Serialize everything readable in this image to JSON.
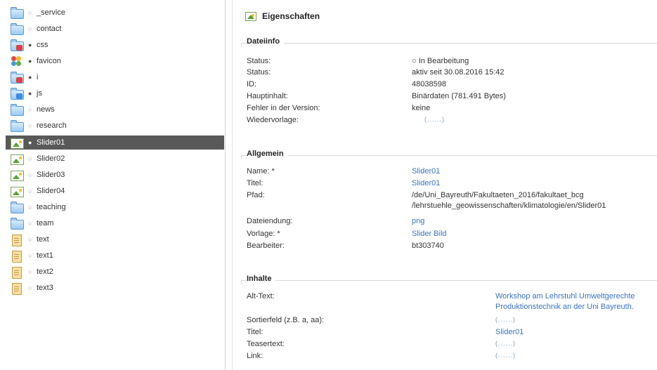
{
  "tree": {
    "items": [
      {
        "label": "_service",
        "icon": "folder-icon",
        "bullet": "○"
      },
      {
        "label": "contact",
        "icon": "folder-icon",
        "bullet": "○"
      },
      {
        "label": "css",
        "icon": "folder-sub-icon",
        "bullet": "●"
      },
      {
        "label": "favicon",
        "icon": "favicon-icon",
        "bullet": "●"
      },
      {
        "label": "i",
        "icon": "folder-sub-icon",
        "bullet": "●"
      },
      {
        "label": "js",
        "icon": "folder-sub-icon",
        "bullet": "●"
      },
      {
        "label": "news",
        "icon": "folder-icon",
        "bullet": "○"
      },
      {
        "label": "research",
        "icon": "folder-icon",
        "bullet": "○"
      },
      {
        "label": "Slider01",
        "icon": "image-icon",
        "bullet": "●",
        "selected": true
      },
      {
        "label": "Slider02",
        "icon": "image-icon",
        "bullet": "○"
      },
      {
        "label": "Slider03",
        "icon": "image-icon",
        "bullet": "○"
      },
      {
        "label": "Slider04",
        "icon": "image-icon",
        "bullet": "○"
      },
      {
        "label": "teaching",
        "icon": "folder-icon",
        "bullet": "○"
      },
      {
        "label": "team",
        "icon": "folder-icon",
        "bullet": "○"
      },
      {
        "label": "text",
        "icon": "document-icon",
        "bullet": "○"
      },
      {
        "label": "text1",
        "icon": "document-icon",
        "bullet": "○"
      },
      {
        "label": "text2",
        "icon": "document-icon",
        "bullet": "○"
      },
      {
        "label": "text3",
        "icon": "document-icon",
        "bullet": "○"
      }
    ]
  },
  "panel": {
    "title": "Eigenschaften",
    "sections": {
      "dateiinfo": {
        "title": "Dateiinfo",
        "rows": [
          {
            "key": "Status:",
            "value": "○ In Bearbeitung",
            "style": "plain"
          },
          {
            "key": "Status:",
            "value": "aktiv seit 30.08.2016 15:42",
            "style": "plain"
          },
          {
            "key": "ID:",
            "value": "48038598",
            "style": "plain"
          },
          {
            "key": "Hauptinhalt:",
            "value": "Binärdaten (781.491 Bytes)",
            "style": "plain"
          },
          {
            "key": "Fehler in der Version:",
            "value": "keine",
            "style": "plain"
          },
          {
            "key": "Wiedervorlage:",
            "value": "(......)",
            "style": "muted"
          }
        ]
      },
      "allgemein": {
        "title": "Allgemein",
        "rows": [
          {
            "key": "Name: *",
            "value": "Slider01",
            "style": "link"
          },
          {
            "key": "Titel:",
            "value": "Slider01",
            "style": "link"
          },
          {
            "key": "Pfad:",
            "value": "/de/Uni_Bayreuth/Fakultaeten_2016/fakultaet_bcg",
            "value2": "/lehrstuehle_geowissenschaften/klimatologie/en/Slider01",
            "style": "plain"
          },
          {
            "key": "Dateiendung:",
            "value": "png",
            "style": "link"
          },
          {
            "key": "Vorlage: *",
            "value": "Slider Bild",
            "style": "link"
          },
          {
            "key": "Bearbeiter:",
            "value": "bt303740",
            "style": "plain"
          }
        ]
      },
      "inhalte": {
        "title": "Inhalte",
        "rows": [
          {
            "key": "Alt-Text:",
            "value": "Workshop am Lehrstuhl Umweltgerechte",
            "value2": "Produktionstechnik an der Uni Bayreuth.",
            "style": "link"
          },
          {
            "key": "Sortierfeld (z.B. a, aa):",
            "value": "(......)",
            "style": "muted"
          },
          {
            "key": "Titel:",
            "value": "Slider01",
            "style": "link"
          },
          {
            "key": "Teasertext:",
            "value": "(......)",
            "style": "muted"
          },
          {
            "key": "Link:",
            "value": "(......)",
            "style": "muted"
          }
        ]
      }
    }
  },
  "colors": {
    "selected_row": "#595959",
    "link": "#3a73c0",
    "folder": "#9ccaf2"
  }
}
